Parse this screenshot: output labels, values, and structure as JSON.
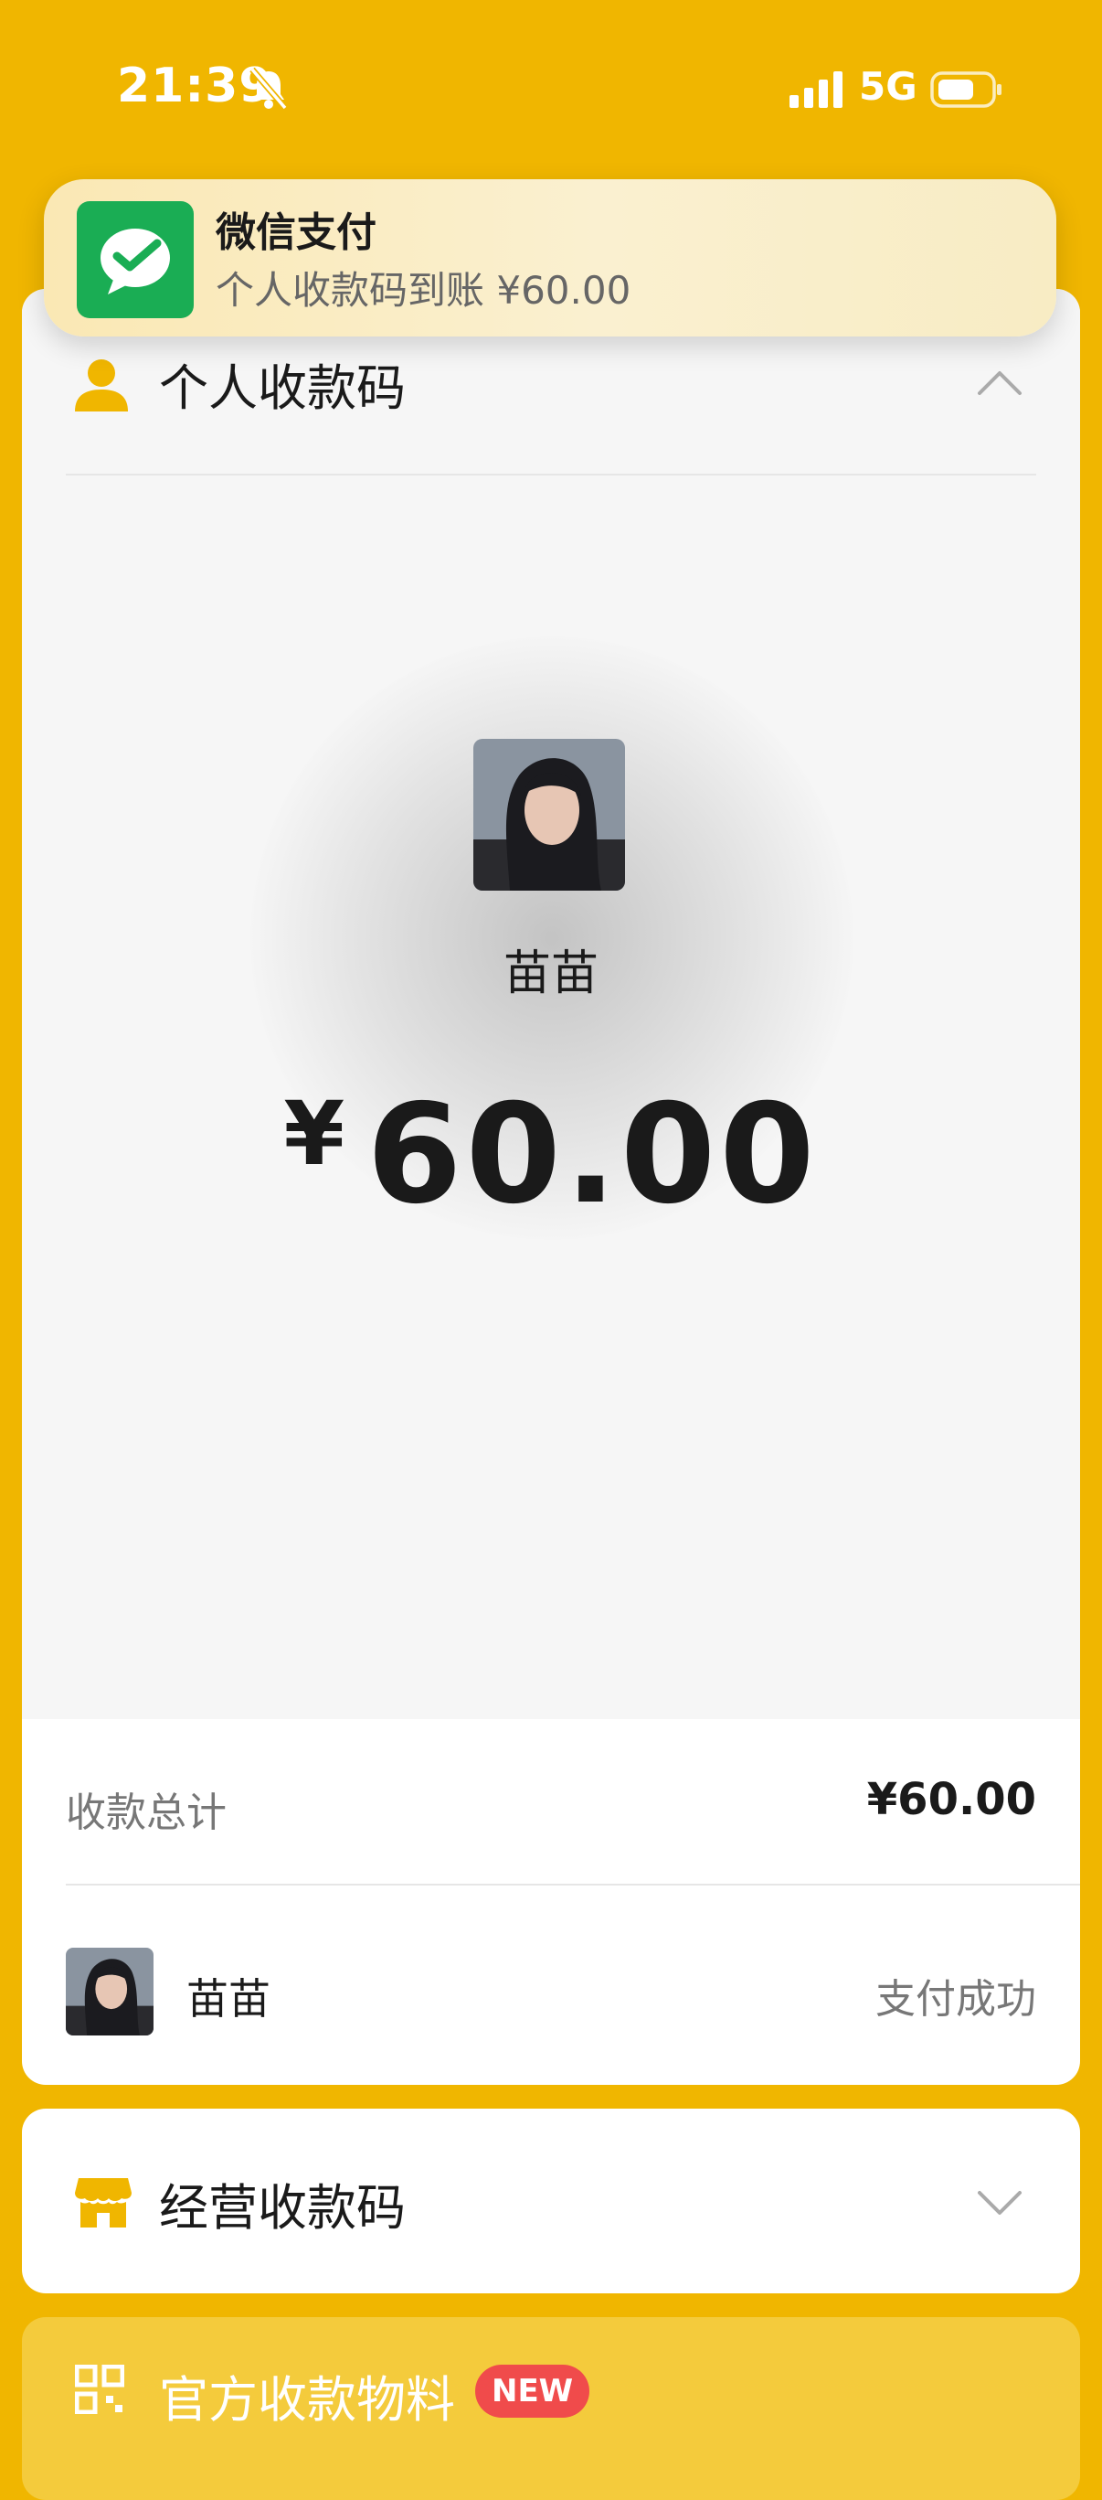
{
  "status_bar": {
    "time": "21:39",
    "network": "5G",
    "icons": [
      "bell-slash-icon",
      "signal-icon",
      "battery-icon"
    ]
  },
  "notification": {
    "app_icon": "wechat-pay-icon",
    "title": "微信支付",
    "body": "个人收款码到账 ¥60.00"
  },
  "personal_code": {
    "icon": "person-icon",
    "title": "个人收款码",
    "collapse_icon": "chevron-up-icon",
    "payer_name": "苗苗",
    "amount_symbol": "¥",
    "amount": "60.00"
  },
  "summary": {
    "label": "收款总计",
    "value": "¥60.00"
  },
  "records": [
    {
      "name": "苗苗",
      "status": "支付成功"
    }
  ],
  "business_code": {
    "icon": "store-icon",
    "title": "经营收款码",
    "expand_icon": "chevron-down-icon"
  },
  "materials": {
    "icon": "qr-code-icon",
    "title": "官方收款物料",
    "badge": "NEW"
  },
  "colors": {
    "background": "#F0B600",
    "wechat_green": "#1AAD54",
    "badge_red": "#F04B4B"
  }
}
